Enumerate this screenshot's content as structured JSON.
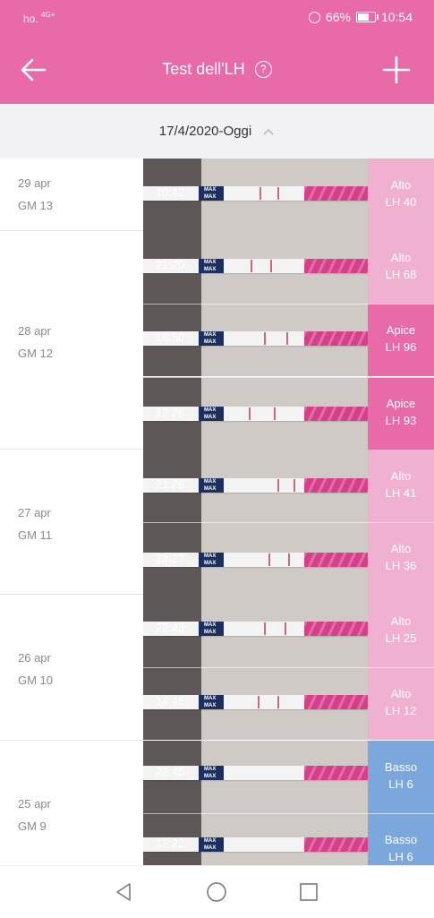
{
  "status": {
    "carrier": "ho.",
    "network": "4G+",
    "battery_pct": "66%",
    "time": "10:54"
  },
  "header": {
    "title": "Test dell'LH",
    "help_glyph": "?"
  },
  "range": {
    "label": "17/4/2020-Oggi"
  },
  "colors": {
    "accent": "#e86aa8",
    "alto": "#f0b0cf",
    "apice": "#e86aa8",
    "basso": "#7ba7dd"
  },
  "groups": [
    {
      "date": "29 apr",
      "cycle": "GM 13"
    },
    {
      "date": "28 apr",
      "cycle": "GM 12"
    },
    {
      "date": "27 apr",
      "cycle": "GM 11"
    },
    {
      "date": "26 apr",
      "cycle": "GM 10"
    },
    {
      "date": "25 apr",
      "cycle": "GM 9"
    }
  ],
  "tests": [
    {
      "time": "10:42",
      "level": "Alto",
      "lh": "LH 40"
    },
    {
      "time": "21:20",
      "level": "Alto",
      "lh": "LH 68"
    },
    {
      "time": "16:50",
      "level": "Apice",
      "lh": "LH 96"
    },
    {
      "time": "12:26",
      "level": "Apice",
      "lh": "LH 93"
    },
    {
      "time": "21:26",
      "level": "Alto",
      "lh": "LH 41"
    },
    {
      "time": "13:27",
      "level": "Alto",
      "lh": "LH 36"
    },
    {
      "time": "22:43",
      "level": "Alto",
      "lh": "LH 25"
    },
    {
      "time": "14:45",
      "level": "Alto",
      "lh": "LH 12"
    },
    {
      "time": "22:45",
      "level": "Basso",
      "lh": "LH 6"
    },
    {
      "time": "12:22",
      "level": "Basso",
      "lh": "LH 6"
    }
  ],
  "strip_text": "MAX"
}
